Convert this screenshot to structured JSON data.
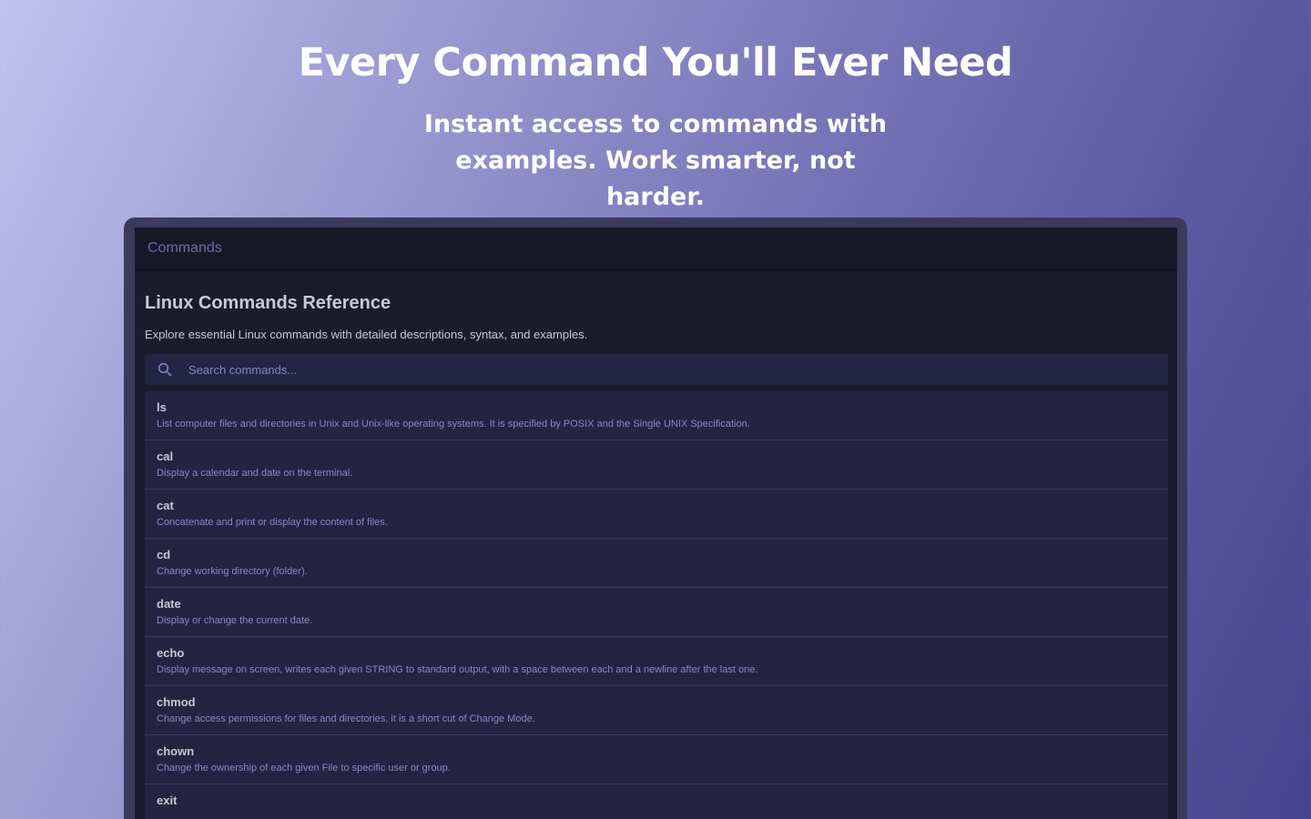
{
  "hero": {
    "title": "Every Command You'll Ever Need",
    "subtitle": "Instant access to commands with examples. Work smarter, not harder."
  },
  "app": {
    "navbar_title": "Commands",
    "heading": "Linux Commands Reference",
    "description": "Explore essential Linux commands with detailed descriptions, syntax, and examples.",
    "search": {
      "placeholder": "Search commands...",
      "icon": "search-icon"
    },
    "commands": [
      {
        "name": "ls",
        "description": "List computer files and directories in Unix and Unix-like operating systems. It is specified by POSIX and the Single UNIX Specification."
      },
      {
        "name": "cal",
        "description": "Display a calendar and date on the terminal."
      },
      {
        "name": "cat",
        "description": "Concatenate and print or display the content of files."
      },
      {
        "name": "cd",
        "description": "Change working directory (folder)."
      },
      {
        "name": "date",
        "description": "Display or change the current date."
      },
      {
        "name": "echo",
        "description": "Display message on screen, writes each given STRING to standard output, with a space between each and a newline after the last one."
      },
      {
        "name": "chmod",
        "description": "Change access permissions for files and directories, it is a short cut of Change Mode."
      },
      {
        "name": "chown",
        "description": "Change the ownership of each given File to specific user or group."
      },
      {
        "name": "exit",
        "description": ""
      }
    ]
  },
  "colors": {
    "accent": "#6d68a8",
    "panel": "#242442",
    "background": "#1b1b2b"
  }
}
